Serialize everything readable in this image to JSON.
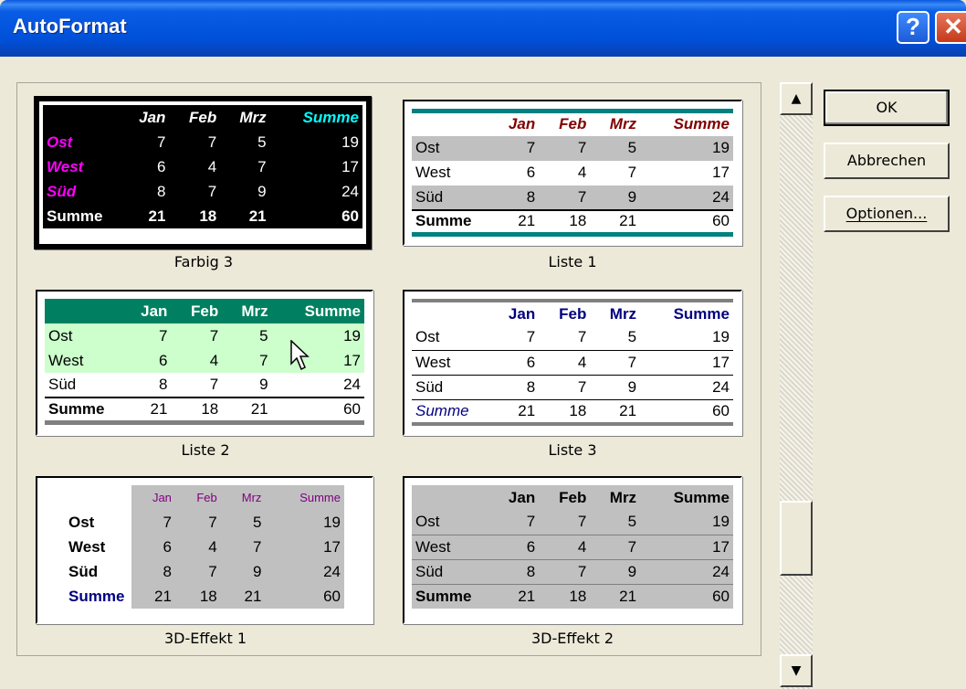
{
  "window": {
    "title": "AutoFormat",
    "help_symbol": "?",
    "close_symbol": "✕"
  },
  "buttons": {
    "ok": "OK",
    "cancel": "Abbrechen",
    "options": "Optionen..."
  },
  "scrollbar": {
    "up_symbol": "▲",
    "down_symbol": "▼"
  },
  "formats": {
    "f1": {
      "name": "Farbig 3",
      "selected": true
    },
    "f2": {
      "name": "Liste 1"
    },
    "f3": {
      "name": "Liste 2"
    },
    "f4": {
      "name": "Liste 3"
    },
    "f5": {
      "name": "3D-Effekt 1"
    },
    "f6": {
      "name": "3D-Effekt 2"
    }
  },
  "sample": {
    "headers": [
      "",
      "Jan",
      "Feb",
      "Mrz",
      "Summe"
    ],
    "rows": [
      [
        "Ost",
        "7",
        "7",
        "5",
        "19"
      ],
      [
        "West",
        "6",
        "4",
        "7",
        "17"
      ],
      [
        "Süd",
        "8",
        "7",
        "9",
        "24"
      ],
      [
        "Summe",
        "21",
        "18",
        "21",
        "60"
      ]
    ]
  },
  "colors": {
    "titlebar": "#0050d8",
    "teal": "#008080",
    "green_header": "#008060",
    "light_green": "#ccffcc",
    "navy": "#000080",
    "maroon": "#800000",
    "magenta": "#ff00ff",
    "cyan": "#00ffff"
  }
}
